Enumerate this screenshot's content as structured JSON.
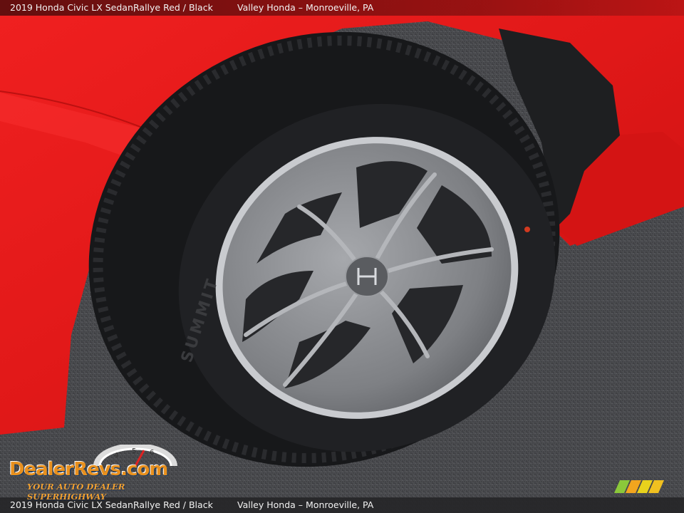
{
  "caption": {
    "vehicle": "2019 Honda Civic LX Sedan,",
    "color": "Rallye Red / Black",
    "dealer": "Valley Honda – Monroeville, PA"
  },
  "watermark": {
    "brand": "DEALERREVS.COM",
    "brand_display": "DealerRevs.com",
    "tagline": "YOUR AUTO DEALER SUPERHIGHWAY"
  },
  "tire": {
    "sidewall_brand": "SUMMIT"
  },
  "colors": {
    "paint": "#e01a1a",
    "tire": "#17181a",
    "wheel": "#8a8c90",
    "asphalt": "#4a4b4e",
    "caption_bar": "#262628"
  },
  "icons": [
    "honda-logo-icon",
    "dealerrevs-logo",
    "tachometer-icon",
    "color-stripes-icon"
  ]
}
